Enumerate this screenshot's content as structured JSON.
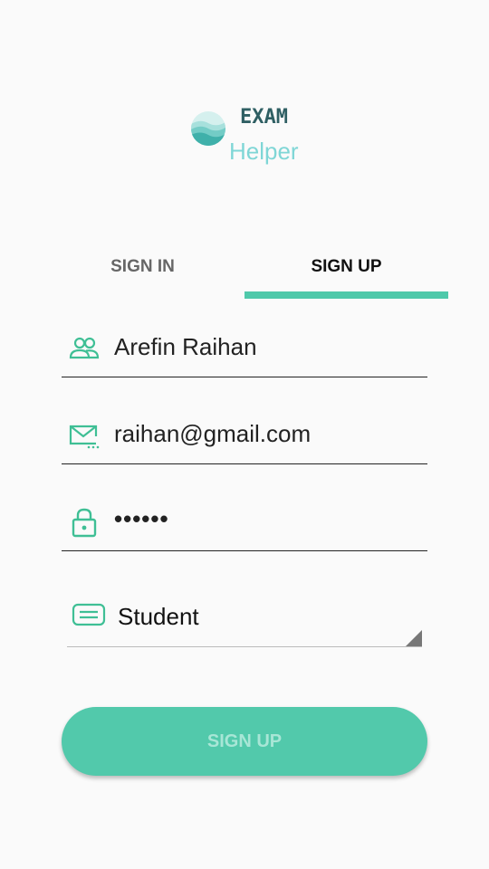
{
  "app": {
    "logo_line1": "EXAM",
    "logo_line2": "Helper",
    "logo_icon": "waves-circle-icon"
  },
  "tabs": [
    {
      "label": "SIGN IN",
      "active": false
    },
    {
      "label": "SIGN UP",
      "active": true
    }
  ],
  "form": {
    "name": {
      "value": "Arefin Raihan",
      "icon": "people-icon"
    },
    "email": {
      "value": "raihan@gmail.com",
      "icon": "mail-icon"
    },
    "password": {
      "value": "••••••",
      "icon": "lock-icon"
    },
    "role": {
      "value": "Student",
      "icon": "id-card-icon"
    },
    "submit_label": "SIGN UP"
  },
  "colors": {
    "accent": "#52c9ab",
    "logo_dark": "#2f5f63",
    "logo_light": "#7fd6d6",
    "background": "#fafafa"
  }
}
